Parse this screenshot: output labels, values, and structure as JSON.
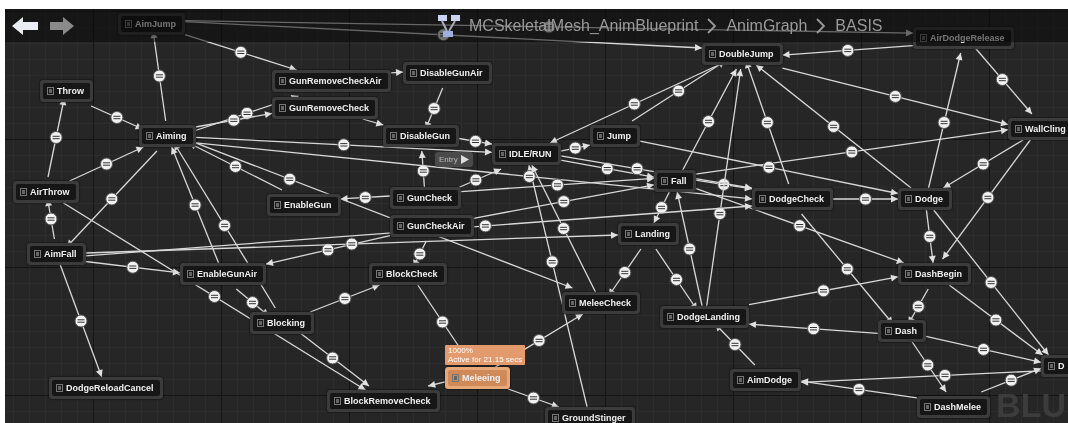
{
  "breadcrumb": {
    "items": [
      "MCSkeletalMesh_AnimBlueprint",
      "AnimGraph",
      "BASIS"
    ]
  },
  "graph": {
    "entry": {
      "label": "Entry"
    },
    "states": [
      {
        "label": "AimJump",
        "active": false
      },
      {
        "label": "AirDodgeRelease",
        "active": false
      },
      {
        "label": "DoubleJump",
        "active": false
      },
      {
        "label": "DisableGunAir",
        "active": false
      },
      {
        "label": "GunRemoveCheckAir",
        "active": false
      },
      {
        "label": "Throw",
        "active": false
      },
      {
        "label": "GunRemoveCheck",
        "active": false
      },
      {
        "label": "WallCling",
        "active": false
      },
      {
        "label": "Aiming",
        "active": false
      },
      {
        "label": "DisableGun",
        "active": false
      },
      {
        "label": "Jump",
        "active": false
      },
      {
        "label": "IDLE/RUN",
        "active": false
      },
      {
        "label": "Fall",
        "active": false
      },
      {
        "label": "AirThrow",
        "active": false
      },
      {
        "label": "GunCheck",
        "active": false
      },
      {
        "label": "DodgeCheck",
        "active": false
      },
      {
        "label": "Dodge",
        "active": false
      },
      {
        "label": "EnableGun",
        "active": false
      },
      {
        "label": "GunCheckAir",
        "active": false
      },
      {
        "label": "Landing",
        "active": false
      },
      {
        "label": "AimFall",
        "active": false
      },
      {
        "label": "EnableGunAir",
        "active": false
      },
      {
        "label": "BlockCheck",
        "active": false
      },
      {
        "label": "DashBegin",
        "active": false
      },
      {
        "label": "MeleeCheck",
        "active": false
      },
      {
        "label": "DodgeLanding",
        "active": false
      },
      {
        "label": "Blocking",
        "active": false
      },
      {
        "label": "Dash",
        "active": false
      },
      {
        "label": "D",
        "active": false
      },
      {
        "label": "Meleeing",
        "active": true,
        "tooltip": {
          "weight": "1000%",
          "time": "Active for 21.15 secs"
        }
      },
      {
        "label": "AimDodge",
        "active": false
      },
      {
        "label": "DodgeReloadCancel",
        "active": false
      },
      {
        "label": "BlockRemoveCheck",
        "active": false
      },
      {
        "label": "DashMelee",
        "active": false
      },
      {
        "label": "GroundStinger",
        "active": false
      }
    ],
    "corner_label": "BLU"
  }
}
